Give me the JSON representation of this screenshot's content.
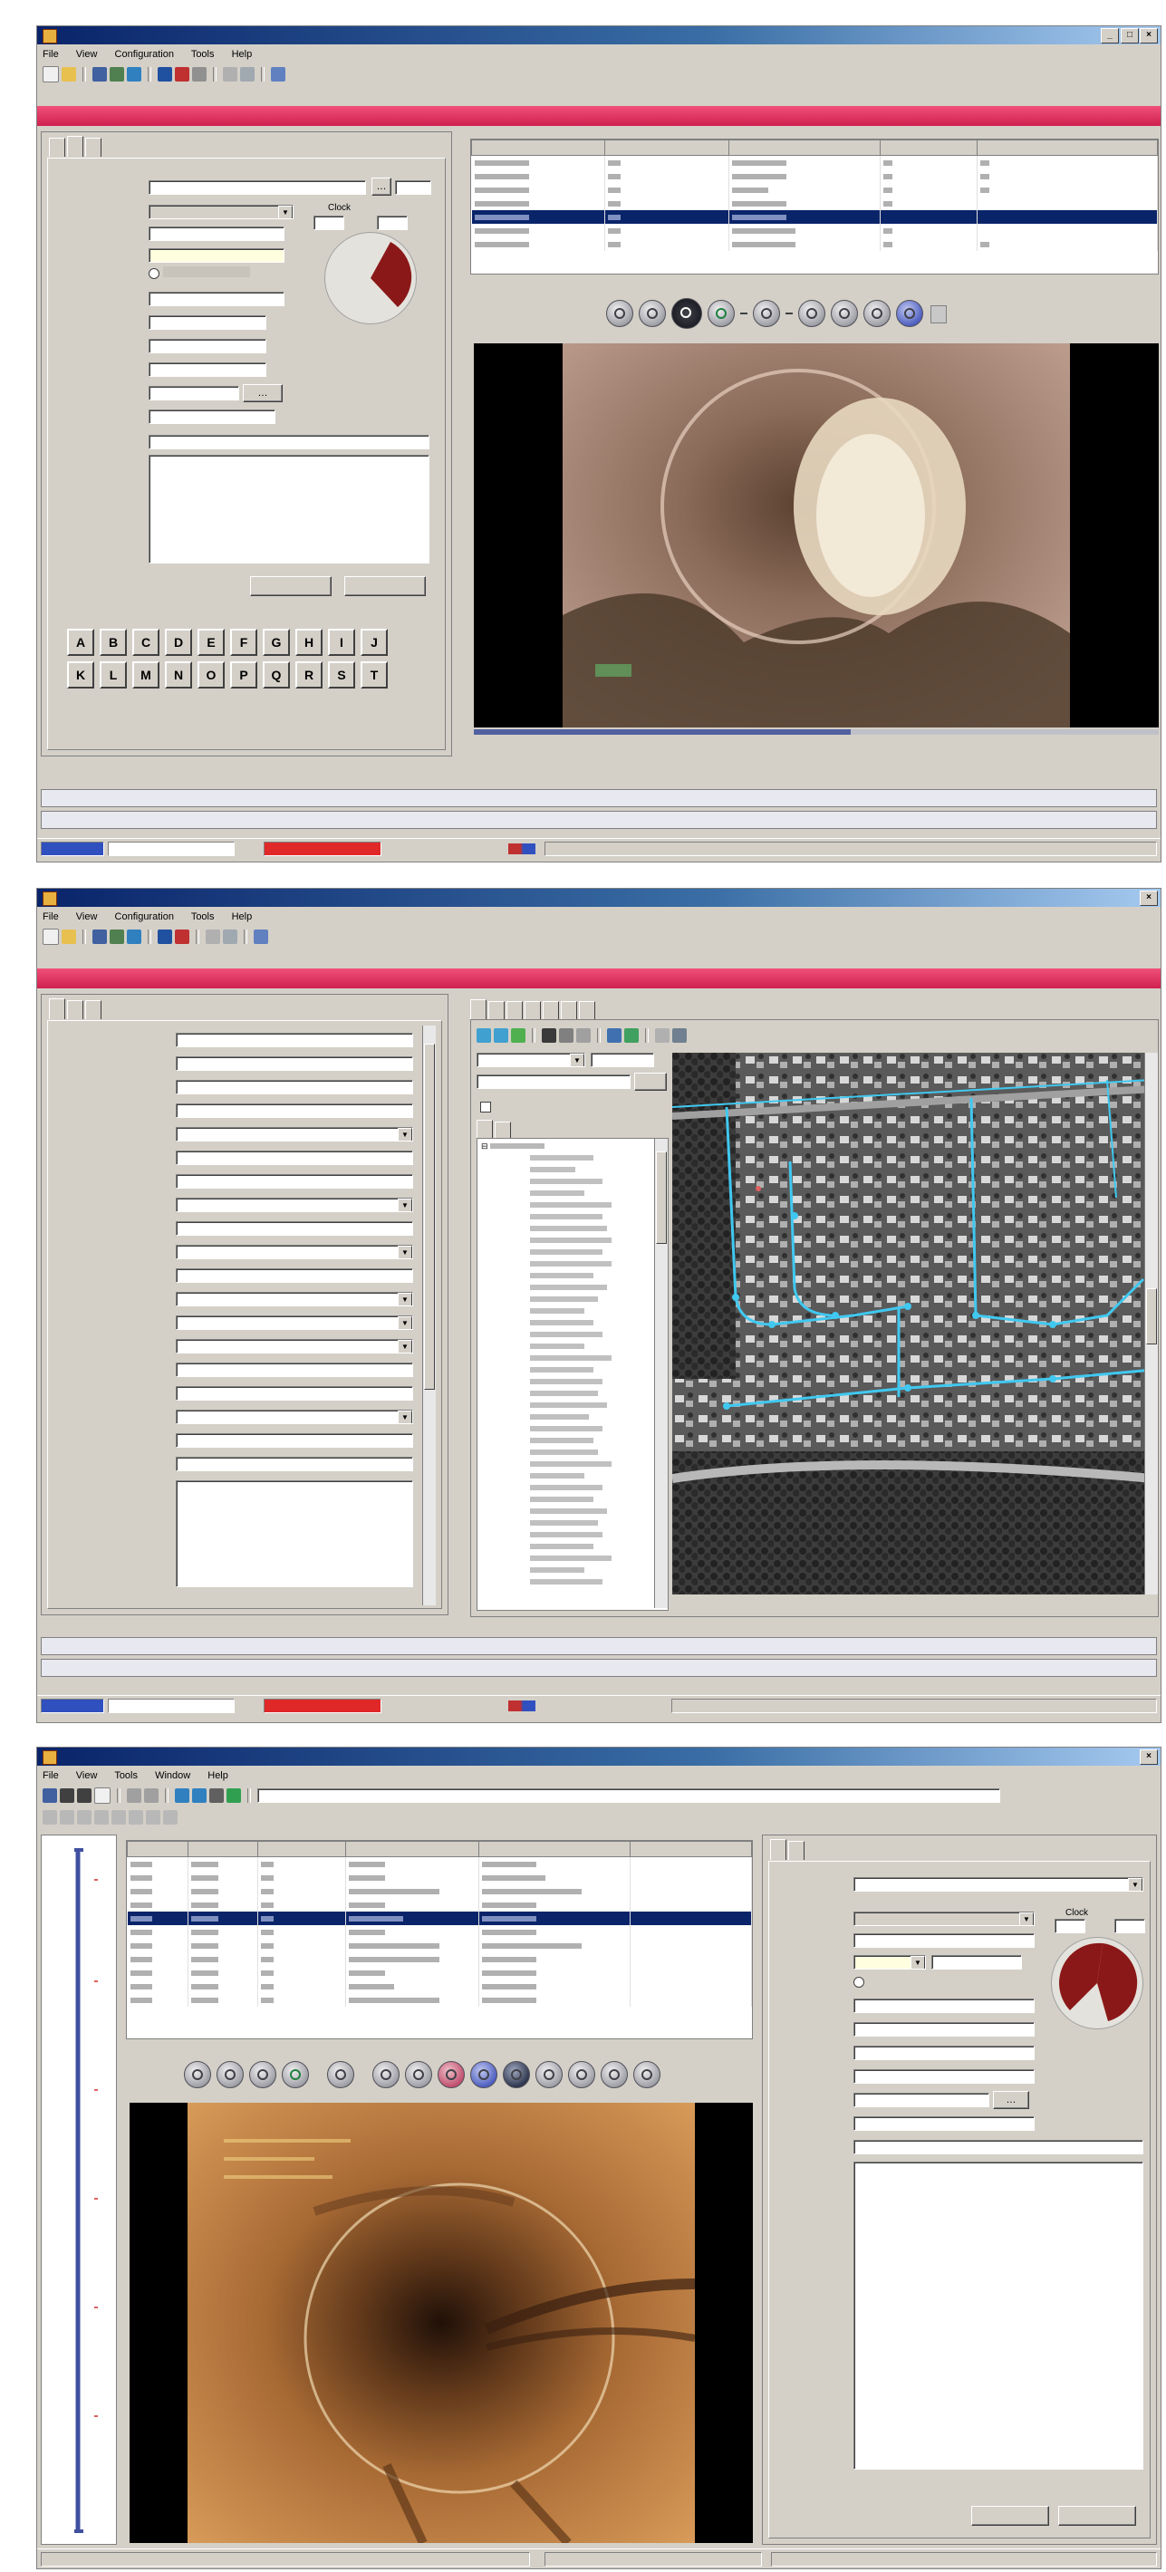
{
  "colors": {
    "title_blue": "#0a246a",
    "accent_red": "#e03060",
    "selection": "#0a246a",
    "gis_line": "#40c8f0",
    "status_red": "#e02828"
  },
  "w1": {
    "title": "",
    "menu": [
      "File",
      "View",
      "Configuration",
      "Tools",
      "Help"
    ],
    "redbar": "",
    "tabs": [
      "",
      "",
      ""
    ],
    "labels": {
      "code": "",
      "clock": "",
      "distance": "",
      "remarks": ""
    },
    "values": {
      "code": "",
      "distance": "",
      "remarks": ""
    },
    "compass_label": "Clock",
    "compass_from": "",
    "compass_to": "",
    "buttons": {
      "ok": "",
      "cancel": ""
    },
    "keys_row1": [
      "A",
      "B",
      "C",
      "D",
      "E",
      "F",
      "G",
      "H",
      "I",
      "J"
    ],
    "keys_row2": [
      "K",
      "L",
      "M",
      "N",
      "O",
      "P",
      "Q",
      "R",
      "S",
      "T"
    ],
    "collapse1": "",
    "collapse2": ""
  },
  "w2": {
    "title": "",
    "menu": [
      "File",
      "View",
      "Configuration",
      "Tools",
      "Help"
    ],
    "redbar": "",
    "tabs": [
      "",
      "",
      ""
    ],
    "maptabs": [
      "",
      "",
      "",
      "",
      "",
      "",
      ""
    ],
    "zoom": "",
    "collapse1": "",
    "collapse2": ""
  },
  "w3": {
    "title": "",
    "menu": [
      "File",
      "View",
      "Tools",
      "Window",
      "Help"
    ],
    "tabs": [
      "",
      ""
    ],
    "compass_label": "Clock",
    "buttons": {
      "ok": "",
      "cancel": ""
    }
  }
}
